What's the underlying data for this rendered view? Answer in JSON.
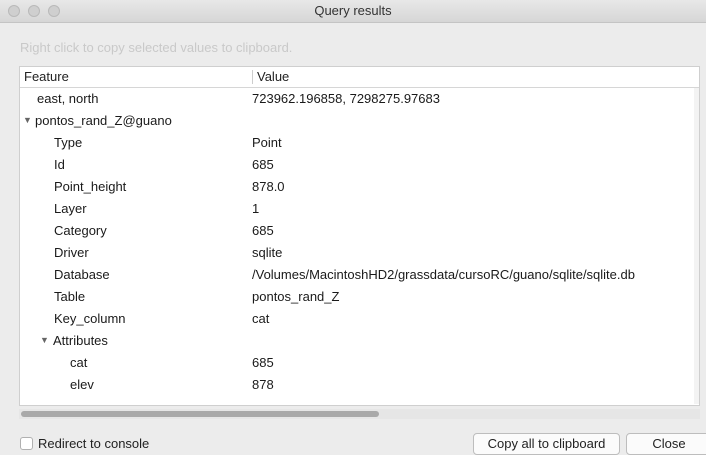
{
  "window": {
    "title": "Query results"
  },
  "hint": "Right click to copy selected values to clipboard.",
  "table": {
    "headers": {
      "feature": "Feature",
      "value": "Value"
    },
    "rows": [
      {
        "feature": "east, north",
        "value": "723962.196858, 7298275.97683",
        "indent": 0,
        "expanded": null
      },
      {
        "feature": "pontos_rand_Z@guano",
        "value": "",
        "indent": 0,
        "expanded": true
      },
      {
        "feature": "Type",
        "value": "Point",
        "indent": 1,
        "expanded": null
      },
      {
        "feature": "Id",
        "value": "685",
        "indent": 1,
        "expanded": null
      },
      {
        "feature": "Point_height",
        "value": "878.0",
        "indent": 1,
        "expanded": null
      },
      {
        "feature": "Layer",
        "value": "1",
        "indent": 1,
        "expanded": null
      },
      {
        "feature": "Category",
        "value": "685",
        "indent": 1,
        "expanded": null
      },
      {
        "feature": "Driver",
        "value": "sqlite",
        "indent": 1,
        "expanded": null
      },
      {
        "feature": "Database",
        "value": "/Volumes/MacintoshHD2/grassdata/cursoRC/guano/sqlite/sqlite.db",
        "indent": 1,
        "expanded": null
      },
      {
        "feature": "Table",
        "value": "pontos_rand_Z",
        "indent": 1,
        "expanded": null
      },
      {
        "feature": "Key_column",
        "value": "cat",
        "indent": 1,
        "expanded": null
      },
      {
        "feature": "Attributes",
        "value": "",
        "indent": 1,
        "expanded": true
      },
      {
        "feature": "cat",
        "value": "685",
        "indent": 2,
        "expanded": null
      },
      {
        "feature": "elev",
        "value": "878",
        "indent": 2,
        "expanded": null
      }
    ]
  },
  "footer": {
    "redirect_label": "Redirect to console",
    "redirect_checked": false,
    "copy_all_label": "Copy all to clipboard",
    "close_label": "Close"
  }
}
